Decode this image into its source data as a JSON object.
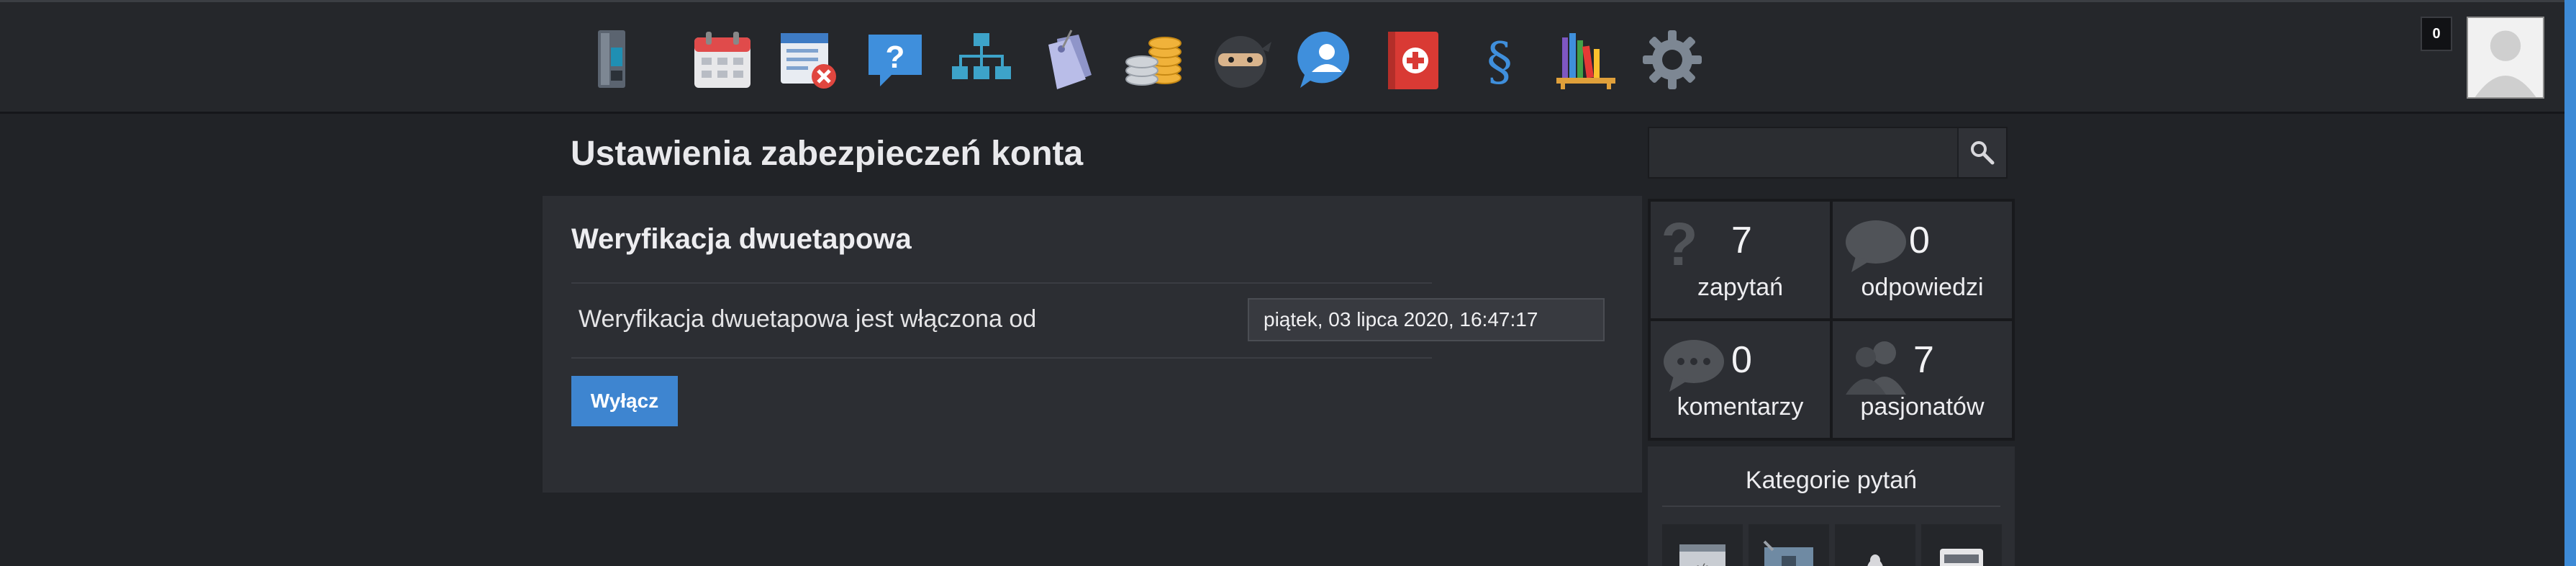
{
  "nav": {
    "icons": [
      {
        "name": "device-icon"
      },
      {
        "name": "calendar-icon"
      },
      {
        "name": "list-remove-icon"
      },
      {
        "name": "question-icon"
      },
      {
        "name": "hierarchy-icon"
      },
      {
        "name": "tags-icon"
      },
      {
        "name": "coins-icon"
      },
      {
        "name": "ninja-icon"
      },
      {
        "name": "user-chat-icon"
      },
      {
        "name": "first-aid-icon"
      },
      {
        "name": "paragraph-icon"
      },
      {
        "name": "bookshelf-icon"
      },
      {
        "name": "gear-icon"
      }
    ]
  },
  "user": {
    "notifications": "0"
  },
  "page": {
    "title": "Ustawienia zabezpieczeń konta"
  },
  "two_factor": {
    "title": "Weryfikacja dwuetapowa",
    "status_label": "Weryfikacja dwuetapowa jest włączona od",
    "enabled_since": "piątek, 03 lipca 2020, 16:47:17",
    "disable_button": "Wyłącz"
  },
  "search": {
    "value": ""
  },
  "stats": {
    "questions": {
      "count": "7",
      "label": "zapytań"
    },
    "answers": {
      "count": "0",
      "label": "odpowiedzi"
    },
    "comments": {
      "count": "0",
      "label": "komentarzy"
    },
    "followers": {
      "count": "7",
      "label": "pasjonatów"
    }
  },
  "categories": {
    "title": "Kategorie pytań"
  },
  "colors": {
    "background": "#212327",
    "panel": "#2c2e33",
    "accent": "#3e85d0"
  }
}
